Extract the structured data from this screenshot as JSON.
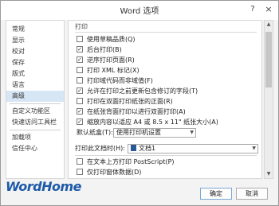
{
  "window": {
    "title": "Word 选项",
    "help_icon": "?",
    "close_icon": "×"
  },
  "sidebar": {
    "items": [
      {
        "label": "常规"
      },
      {
        "label": "显示"
      },
      {
        "label": "校对"
      },
      {
        "label": "保存"
      },
      {
        "label": "版式"
      },
      {
        "label": "语言"
      },
      {
        "label": "高级",
        "active": true
      },
      {
        "label": "自定义功能区"
      },
      {
        "label": "快速访问工具栏"
      },
      {
        "label": "加载项"
      },
      {
        "label": "信任中心"
      }
    ]
  },
  "print_section": {
    "title": "打印",
    "options": [
      {
        "label": "使用草稿品质(Q)",
        "checked": false
      },
      {
        "label": "后台打印(B)",
        "checked": true
      },
      {
        "label": "逆序打印页面(R)",
        "checked": true
      },
      {
        "label": "打印 XML 标记(X)",
        "checked": false
      },
      {
        "label": "打印域代码而非域值(F)",
        "checked": false
      },
      {
        "label": "允许在打印之前更新包含修订的字段(T)",
        "checked": true
      },
      {
        "label": "打印在双面打印纸张的正面(R)",
        "checked": false
      },
      {
        "label": "在纸张背面打印以进行双面打印(A)",
        "checked": true
      },
      {
        "label": "缩放内容以适应 A4 或 8.5 x 11\" 纸张大小(A)",
        "checked": true
      }
    ],
    "tray_label": "默认纸盒(T):",
    "tray_value": "使用打印机设置"
  },
  "doc_section": {
    "label": "打印此文档时(H):",
    "doc_name": "文档1",
    "options": [
      {
        "label": "在文本上方打印 PostScript(P)",
        "checked": false
      },
      {
        "label": "仅打印窗体数据(D)",
        "checked": false
      }
    ]
  },
  "footer": {
    "ok_label": "确定",
    "cancel_label": "取消"
  },
  "watermark": "WordHome"
}
